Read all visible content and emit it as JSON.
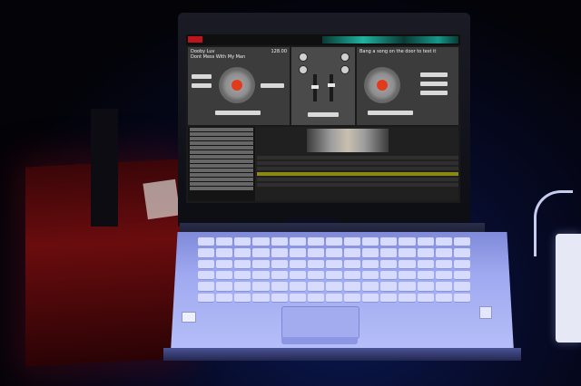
{
  "software": {
    "deck_left": {
      "title": "Dooby Luv",
      "subtitle": "Dont Mess With My Man",
      "bpm": "128.00"
    },
    "deck_right": {
      "title": "Bang a song on the door to test it",
      "bpm": ""
    }
  },
  "colors": {
    "ambient": "#0b1a55",
    "laptop_base": "#b6bff8",
    "accent_red": "#c0141c",
    "platter_dot": "#e23b1c"
  }
}
